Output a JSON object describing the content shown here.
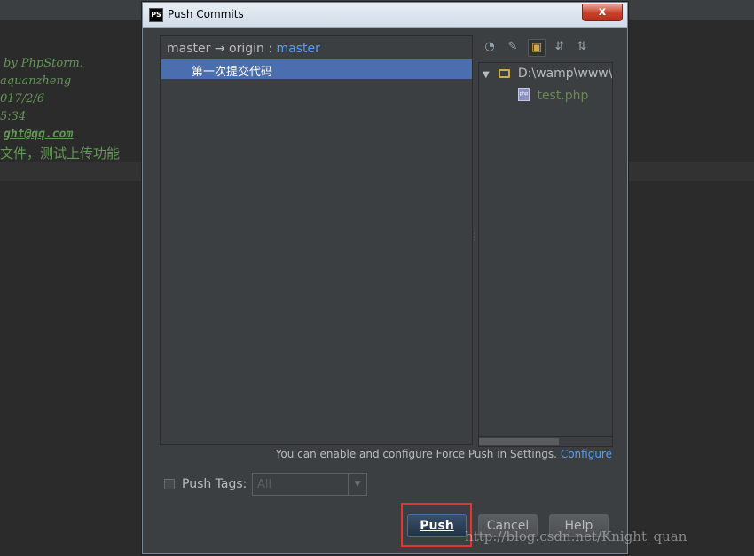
{
  "editor": {
    "lines": [
      "by PhpStorm.",
      "aquanzheng",
      "017/2/6",
      "5:34",
      "ght@qq.com",
      "文件，测试上传功能"
    ]
  },
  "dialog": {
    "app_icon": "PS",
    "title": "Push Commits",
    "close_label": "x"
  },
  "commits": {
    "local_branch": "master",
    "arrow": "→",
    "remote": "origin",
    "separator": ":",
    "remote_branch": "master",
    "items": [
      {
        "message": "第一次提交代码"
      }
    ]
  },
  "files": {
    "toolbar_icons": [
      "diff-icon",
      "edit-source-icon",
      "group-by-directory-icon",
      "expand-all-icon",
      "collapse-all-icon"
    ],
    "root_path": "D:\\wamp\\www\\t",
    "file_name": "test.php",
    "file_icon_text": "php"
  },
  "force_push": {
    "note": "You can enable and configure Force Push in Settings.",
    "link": "Configure"
  },
  "tags": {
    "label": "Push Tags:",
    "selected": "All"
  },
  "buttons": {
    "push": "Push",
    "cancel": "Cancel",
    "help": "Help"
  },
  "watermark": "http://blog.csdn.net/Knight_quan",
  "colors": {
    "selection": "#4b6eaf",
    "link": "#589df6",
    "highlight": "#e8342c"
  }
}
